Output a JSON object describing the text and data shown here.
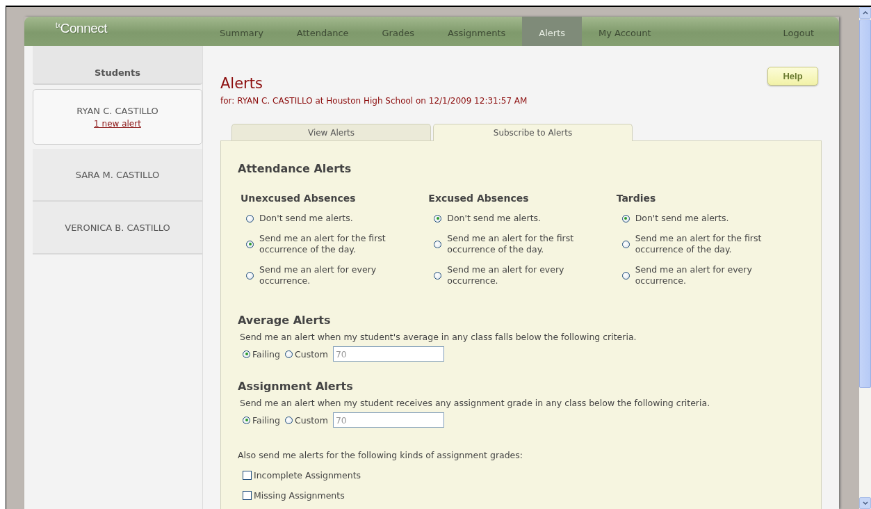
{
  "header": {
    "logo": "$^{tx}$Connect",
    "nav": [
      {
        "label": "Summary",
        "selected": false
      },
      {
        "label": "Attendance",
        "selected": false
      },
      {
        "label": "Grades",
        "selected": false
      },
      {
        "label": "Assignments",
        "selected": false
      },
      {
        "label": "Alerts",
        "selected": true
      },
      {
        "label": "My Account",
        "selected": false
      }
    ],
    "logout": "Logout"
  },
  "sidebar": {
    "heading": "Students",
    "students": [
      {
        "name": "RYAN C. CASTILLO",
        "alert_link": "1 new alert",
        "selected": true
      },
      {
        "name": "SARA M. CASTILLO",
        "selected": false
      },
      {
        "name": "VERONICA B. CASTILLO",
        "selected": false
      }
    ]
  },
  "main": {
    "title": "Alerts",
    "subtitle": "for: RYAN C. CASTILLO at Houston High School on 12/1/2009 12:31:57 AM",
    "help_button": "Help",
    "tabs": [
      {
        "label": "View Alerts",
        "selected": false
      },
      {
        "label": "Subscribe to Alerts",
        "selected": true
      }
    ],
    "attendance": {
      "heading": "Attendance Alerts",
      "groups": [
        {
          "heading": "Unexcused Absences",
          "options": [
            {
              "label": "Don't send me alerts.",
              "selected": false
            },
            {
              "label": "Send me an alert for the first occurrence of the day.",
              "selected": true
            },
            {
              "label": "Send me an alert for every occurrence.",
              "selected": false
            }
          ]
        },
        {
          "heading": "Excused Absences",
          "options": [
            {
              "label": "Don't send me alerts.",
              "selected": true
            },
            {
              "label": "Send me an alert for the first occurrence of the day.",
              "selected": false
            },
            {
              "label": "Send me an alert for every occurrence.",
              "selected": false
            }
          ]
        },
        {
          "heading": "Tardies",
          "options": [
            {
              "label": "Don't send me alerts.",
              "selected": true
            },
            {
              "label": "Send me an alert for the first occurrence of the day.",
              "selected": false
            },
            {
              "label": "Send me an alert for every occurrence.",
              "selected": false
            }
          ]
        }
      ]
    },
    "criteria_sections": [
      {
        "heading": "Average Alerts",
        "description": "Send me an alert when my student's average in any class falls below the following criteria.",
        "options": [
          {
            "label": "Failing",
            "selected": true
          },
          {
            "label": "Custom",
            "selected": false
          }
        ],
        "field": {
          "value": "70",
          "disabled": true
        }
      },
      {
        "heading": "Assignment Alerts",
        "description": "Send me an alert when my student receives any assignment grade in any class below the following criteria.",
        "options": [
          {
            "label": "Failing",
            "selected": true
          },
          {
            "label": "Custom",
            "selected": false
          }
        ],
        "field": {
          "value": "70",
          "disabled": true
        }
      }
    ],
    "extra": {
      "intro": "Also send me alerts for the following kinds of assignment grades:",
      "checkboxes": [
        {
          "label": "Incomplete Assignments",
          "checked": false
        },
        {
          "label": "Missing Assignments",
          "checked": false
        }
      ]
    }
  }
}
